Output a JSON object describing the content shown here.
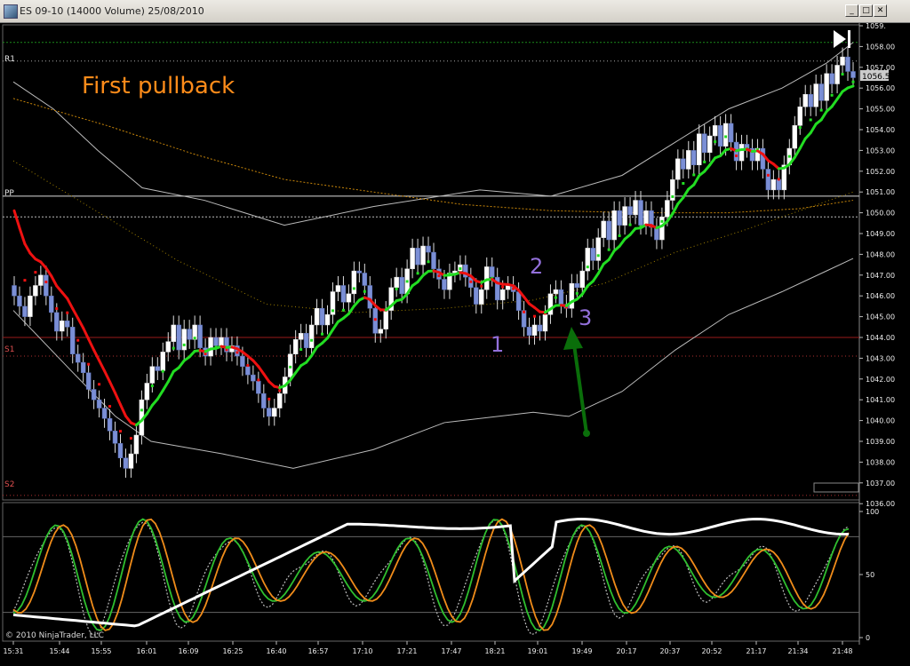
{
  "window": {
    "title": "ES 09-10 (14000 Volume)  25/08/2010",
    "minimize_label": "_",
    "maximize_label": "□",
    "close_label": "✕",
    "dropdown_label": "▼"
  },
  "annotations": {
    "headline": "First pullback",
    "point1": "1",
    "point2": "2",
    "point3": "3",
    "copyright": "© 2010 NinjaTrader, LLC",
    "play_icon": "play-icon"
  },
  "price_panel": {
    "current_price": "1056.50",
    "pivot_labels": {
      "r1": "R1",
      "pp": "PP",
      "s1": "S1",
      "s2": "S2"
    },
    "y_ticks": [
      "1059.",
      "1058.00",
      "1057.00",
      "1056.00",
      "1055.00",
      "1054.00",
      "1053.00",
      "1052.00",
      "1051.00",
      "1050.00",
      "1049.00",
      "1048.00",
      "1047.00",
      "1046.00",
      "1045.00",
      "1044.00",
      "1043.00",
      "1042.00",
      "1041.00",
      "1040.00",
      "1039.00",
      "1038.00",
      "1037.00",
      "1036.00"
    ]
  },
  "oscillator_panel": {
    "y_ticks": [
      "100",
      "50",
      "0"
    ]
  },
  "x_ticks": [
    "15:31",
    "15:44",
    "15:55",
    "16:01",
    "16:09",
    "16:25",
    "16:40",
    "16:57",
    "17:10",
    "17:21",
    "17:47",
    "18:21",
    "19:01",
    "19:49",
    "20:17",
    "20:37",
    "20:52",
    "21:17",
    "21:34",
    "21:48"
  ],
  "colors": {
    "up_candle": "#ffffff",
    "down_candle": "#7b8fd6",
    "ma_up": "#22dd22",
    "ma_down": "#ee1111",
    "headline": "#ff8c1a",
    "point_labels": "#9370db",
    "arrow": "#0a6e0a"
  }
}
